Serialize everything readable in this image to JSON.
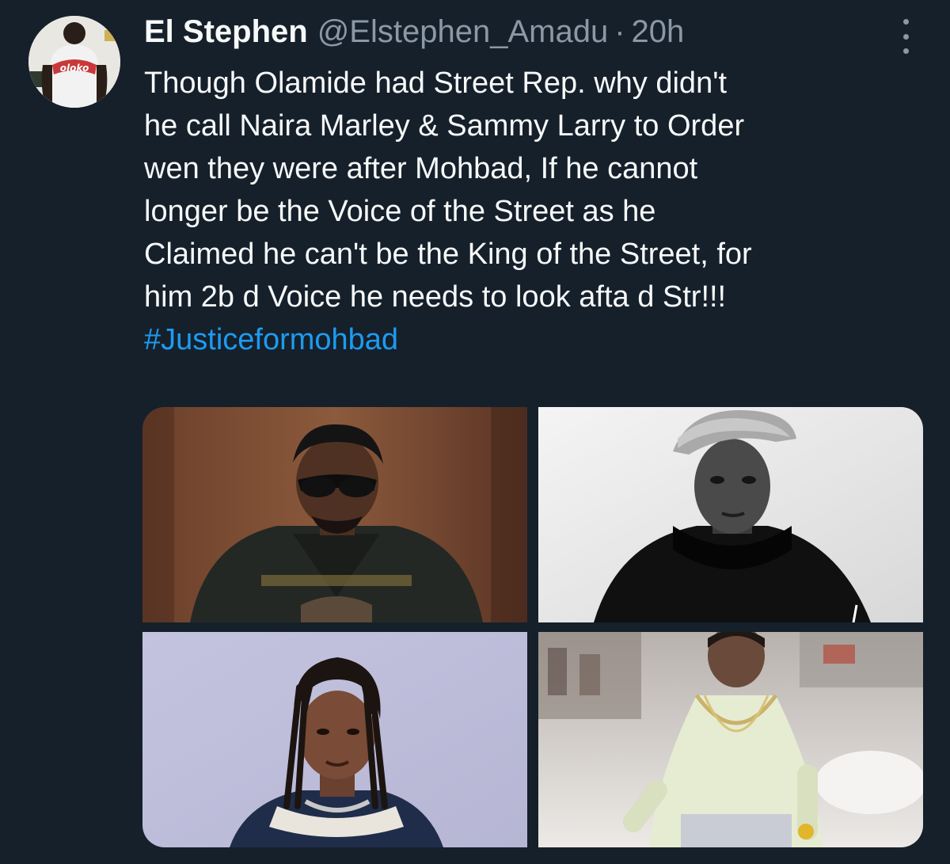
{
  "tweet": {
    "display_name": "El Stephen",
    "handle": "@Elstephen_Amadu",
    "separator": "·",
    "time": "20h",
    "text_lines": [
      "Though Olamide had Street Rep. why didn't",
      "he call Naira Marley & Sammy Larry to Order",
      "wen they were after Mohbad, If he cannot",
      "longer be the Voice of the Street as he",
      "Claimed he can't be the King of the Street, for",
      "him 2b d Voice he needs to look afta d Str!!!"
    ],
    "hashtag": "#Justiceformohbad",
    "avatar_text": "oloko"
  },
  "colors": {
    "background": "#15202b",
    "text": "#f7f9f9",
    "muted": "#8b98a5",
    "link": "#1d9bf0"
  },
  "icons": {
    "more": "more-vertical-icon"
  }
}
